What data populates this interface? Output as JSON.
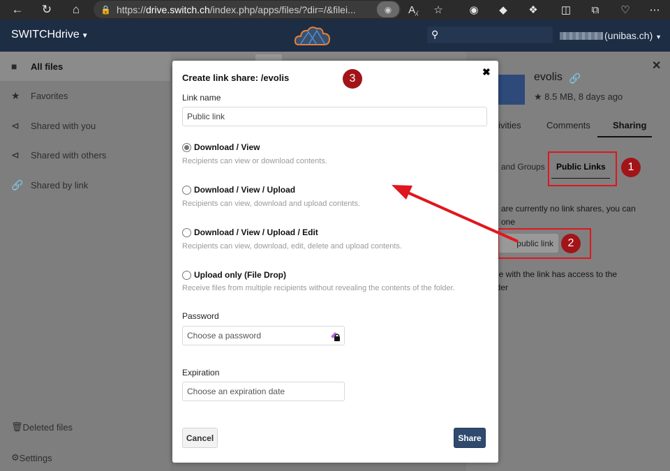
{
  "browser": {
    "url_prefix": "https://",
    "url_host": "drive.switch.ch",
    "url_rest": "/index.php/apps/files/?dir=/&filei..."
  },
  "header": {
    "brand": "SWITCHdrive",
    "user_suffix": "(unibas.ch)"
  },
  "sidebar": {
    "items": [
      {
        "label": "All files",
        "icon": "folder-icon"
      },
      {
        "label": "Favorites",
        "icon": "star-icon"
      },
      {
        "label": "Shared with you",
        "icon": "share-icon"
      },
      {
        "label": "Shared with others",
        "icon": "share-icon"
      },
      {
        "label": "Shared by link",
        "icon": "link-icon"
      }
    ],
    "deleted": "Deleted files",
    "settings": "Settings"
  },
  "details": {
    "filename": "evolis",
    "meta": "8.5 MB, 8 days ago",
    "tabs": [
      "ctivities",
      "Comments",
      "Sharing"
    ],
    "subtabs": [
      "and Groups",
      "Public Links"
    ],
    "no_shares_line1": "e are currently no link shares, you can",
    "no_shares_line2": "e one",
    "create_button": "public link",
    "access_line1": "ne with the link has access to the",
    "access_line2": "lder"
  },
  "annotations": {
    "badge1": "1",
    "badge2": "2",
    "badge3": "3",
    "color": "#e0161e"
  },
  "modal": {
    "title": "Create link share: /evolis",
    "link_name_label": "Link name",
    "link_name_value": "Public link",
    "options": [
      {
        "label": "Download / View",
        "desc": "Recipients can view or download contents.",
        "checked": true
      },
      {
        "label": "Download / View / Upload",
        "desc": "Recipients can view, download and upload contents.",
        "checked": false
      },
      {
        "label": "Download / View / Upload / Edit",
        "desc": "Recipients can view, download, edit, delete and upload contents.",
        "checked": false
      },
      {
        "label": "Upload only (File Drop)",
        "desc": "Receive files from multiple recipients without revealing the contents of the folder.",
        "checked": false
      }
    ],
    "password_label": "Password",
    "password_placeholder": "Choose a password",
    "expiration_label": "Expiration",
    "expiration_placeholder": "Choose an expiration date",
    "cancel": "Cancel",
    "share": "Share"
  }
}
